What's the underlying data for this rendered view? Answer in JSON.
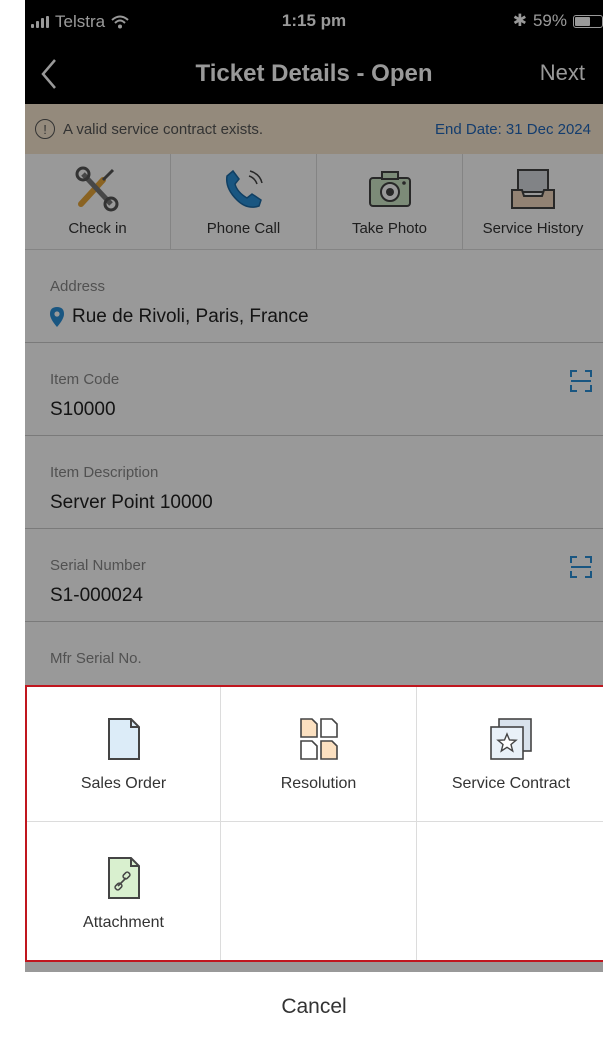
{
  "status": {
    "carrier": "Telstra",
    "time": "1:15 pm",
    "battery": "59%",
    "battery_level": 0.59
  },
  "nav": {
    "title": "Ticket Details - Open",
    "next": "Next"
  },
  "banner": {
    "message": "A valid service contract exists.",
    "end_date": "End Date: 31 Dec 2024",
    "text_color": "#2266b8",
    "background": "#f7e7cf"
  },
  "actions": [
    {
      "label": "Check in",
      "icon": "tools-icon"
    },
    {
      "label": "Phone Call",
      "icon": "phone-icon"
    },
    {
      "label": "Take Photo",
      "icon": "camera-icon"
    },
    {
      "label": "Service History",
      "icon": "inbox-tray-icon"
    }
  ],
  "fields": [
    {
      "label": "Address",
      "value": "Rue de Rivoli, Paris, France"
    },
    {
      "label": "Item Code",
      "value": "S10000"
    },
    {
      "label": "Item Description",
      "value": "Server Point 10000"
    },
    {
      "label": "Serial Number",
      "value": "S1-000024"
    },
    {
      "label": "Mfr Serial No."
    }
  ],
  "sheet": {
    "options": [
      {
        "label": "Sales Order",
        "icon": "document-icon"
      },
      {
        "label": "Resolution",
        "icon": "resolution-docs-icon"
      },
      {
        "label": "Service Contract",
        "icon": "star-certificate-icon"
      },
      {
        "label": "Attachment",
        "icon": "attachment-link-icon"
      }
    ],
    "cancel": "Cancel",
    "highlight_color": "#c0161e"
  }
}
